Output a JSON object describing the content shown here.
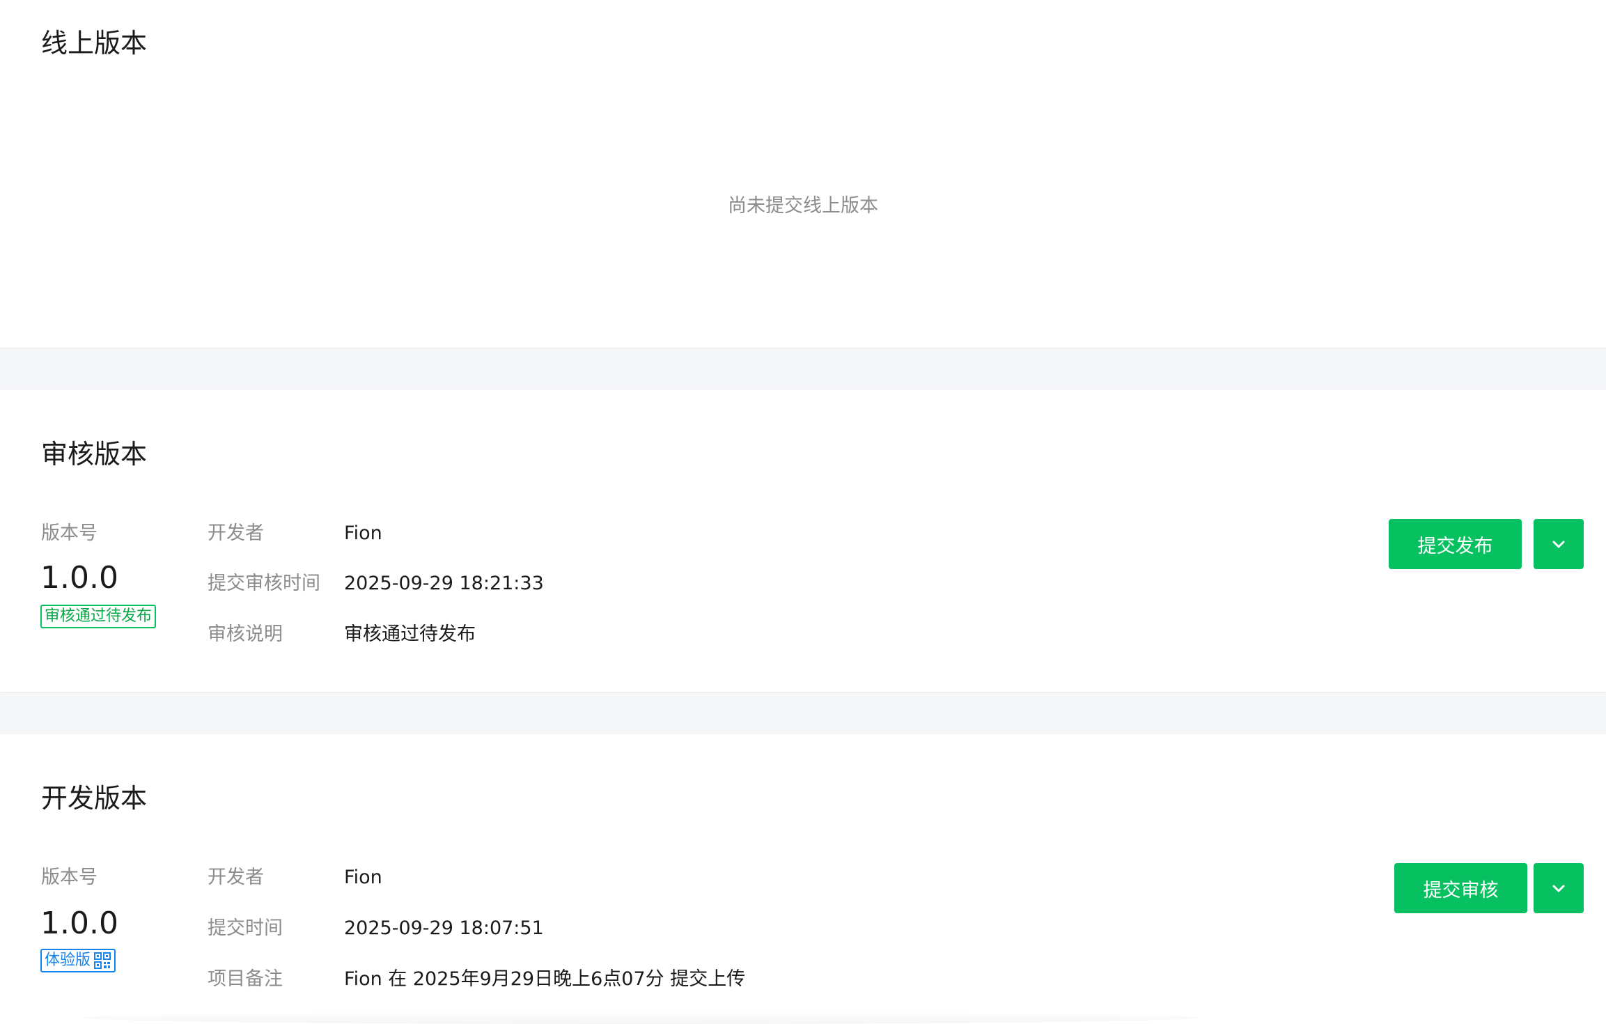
{
  "online": {
    "title": "线上版本",
    "empty_text": "尚未提交线上版本"
  },
  "review": {
    "title": "审核版本",
    "version_label": "版本号",
    "version": "1.0.0",
    "status_tag": "审核通过待发布",
    "fields": [
      {
        "key": "开发者",
        "value": "Fion"
      },
      {
        "key": "提交审核时间",
        "value": "2025-09-29 18:21:33"
      },
      {
        "key": "审核说明",
        "value": "审核通过待发布"
      }
    ],
    "primary_button": "提交发布",
    "dropdown_icon": "chevron-down-icon"
  },
  "dev": {
    "title": "开发版本",
    "version_label": "版本号",
    "version": "1.0.0",
    "status_tag": "体验版",
    "tag_icon": "qr-code-icon",
    "fields": [
      {
        "key": "开发者",
        "value": "Fion"
      },
      {
        "key": "提交时间",
        "value": "2025-09-29 18:07:51"
      },
      {
        "key": "项目备注",
        "value": "Fion 在 2025年9月29日晚上6点07分 提交上传"
      }
    ],
    "primary_button": "提交审核",
    "dropdown_icon": "chevron-down-icon"
  },
  "colors": {
    "accent": "#07c160",
    "tag_green": "#07a846",
    "tag_blue": "#1485ee",
    "muted_text": "#8c8c8c",
    "page_bg": "#f6f7f9"
  }
}
